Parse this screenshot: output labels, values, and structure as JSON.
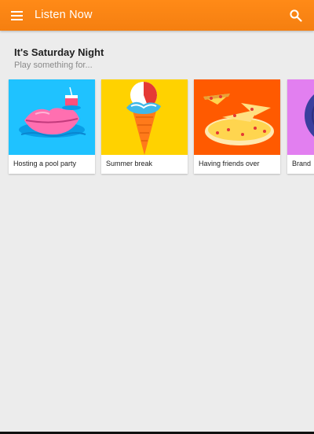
{
  "header": {
    "title": "Listen Now",
    "color": "#f98214"
  },
  "section": {
    "title": "It's Saturday Night",
    "subtitle": "Play something for..."
  },
  "cards": [
    {
      "label": "Hosting a pool party",
      "art_color": "#1fc2ff"
    },
    {
      "label": "Summer break",
      "art_color": "#ffd200"
    },
    {
      "label": "Having friends over",
      "art_color": "#ff5a00"
    },
    {
      "label": "Brand",
      "art_color": "#e27ff0"
    }
  ]
}
